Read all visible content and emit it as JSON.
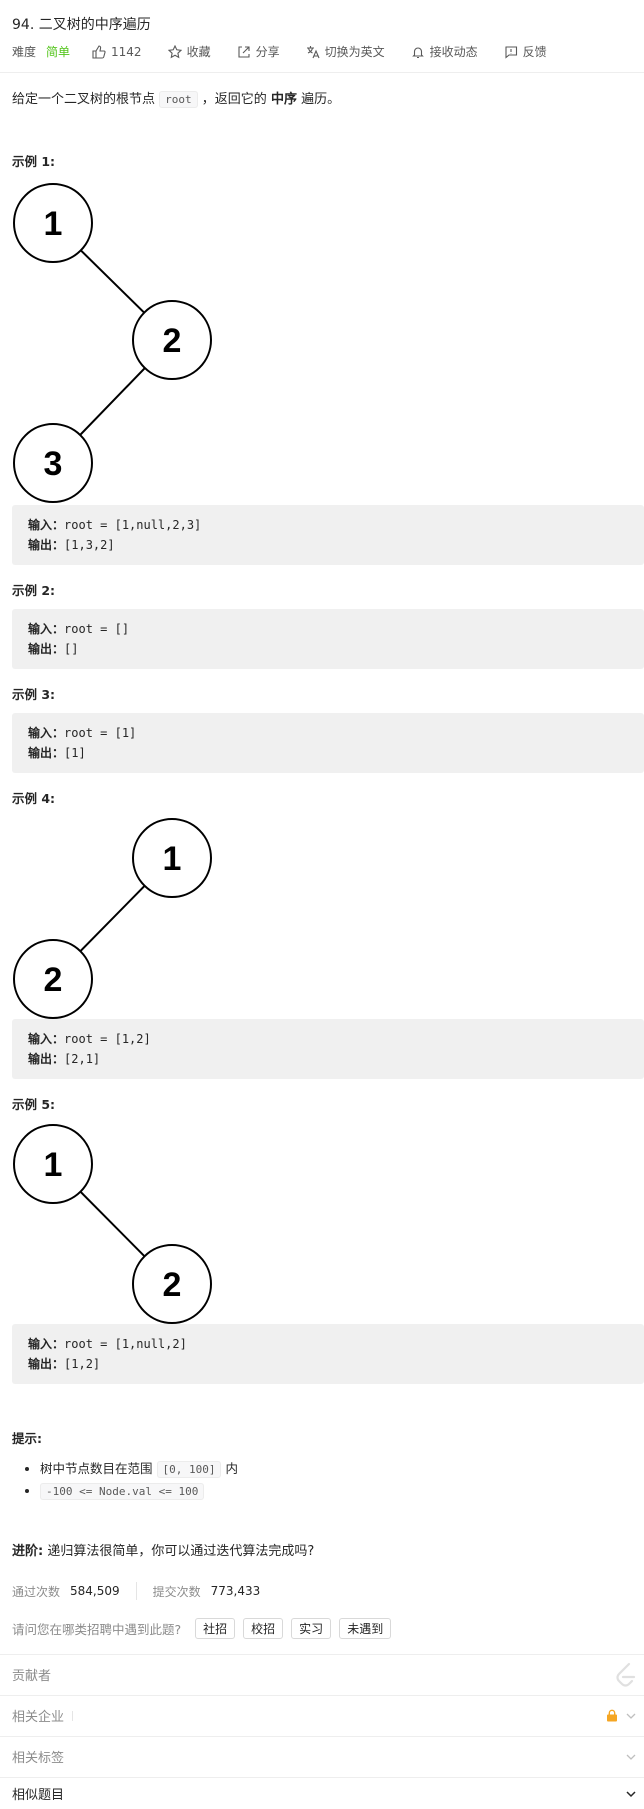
{
  "problem": {
    "title": "94. 二叉树的中序遍历",
    "difficulty_label": "难度",
    "difficulty": "简单",
    "likes": "1142",
    "favorite": "收藏",
    "share": "分享",
    "switch_lang": "切换为英文",
    "subscribe": "接收动态",
    "feedback": "反馈"
  },
  "description": {
    "prefix": "给定一个二叉树的根节点",
    "code": "root",
    "middle": "，返回它的",
    "bold": "中序",
    "suffix": "遍历。"
  },
  "labels": {
    "input": "输入：",
    "output": "输出："
  },
  "examples": [
    {
      "title": "示例 1:",
      "input": "root = [1,null,2,3]",
      "output": "[1,3,2]",
      "nodes": [
        "1",
        "2",
        "3"
      ]
    },
    {
      "title": "示例 2:",
      "input": "root = []",
      "output": "[]"
    },
    {
      "title": "示例 3:",
      "input": "root = [1]",
      "output": "[1]"
    },
    {
      "title": "示例 4:",
      "input": "root = [1,2]",
      "output": "[2,1]",
      "nodes": [
        "1",
        "2"
      ]
    },
    {
      "title": "示例 5:",
      "input": "root = [1,null,2]",
      "output": "[1,2]",
      "nodes": [
        "1",
        "2"
      ]
    }
  ],
  "hints": {
    "title": "提示:",
    "item1_prefix": "树中节点数目在范围",
    "item1_code": "[0, 100]",
    "item1_suffix": "内",
    "item2_code": "-100 <= Node.val <= 100"
  },
  "advanced": {
    "label": "进阶:",
    "text": "递归算法很简单，你可以通过迭代算法完成吗?"
  },
  "stats": {
    "accepted_label": "通过次数",
    "accepted": "584,509",
    "submissions_label": "提交次数",
    "submissions": "773,433"
  },
  "recruit": {
    "question": "请问您在哪类招聘中遇到此题?",
    "tags": [
      "社招",
      "校招",
      "实习",
      "未遇到"
    ]
  },
  "sections": {
    "contributors": "贡献者",
    "companies": "相关企业",
    "tags": "相关标签",
    "similar": "相似题目"
  },
  "colors": {
    "easy": "#52c41a",
    "lock": "#f5a623"
  }
}
